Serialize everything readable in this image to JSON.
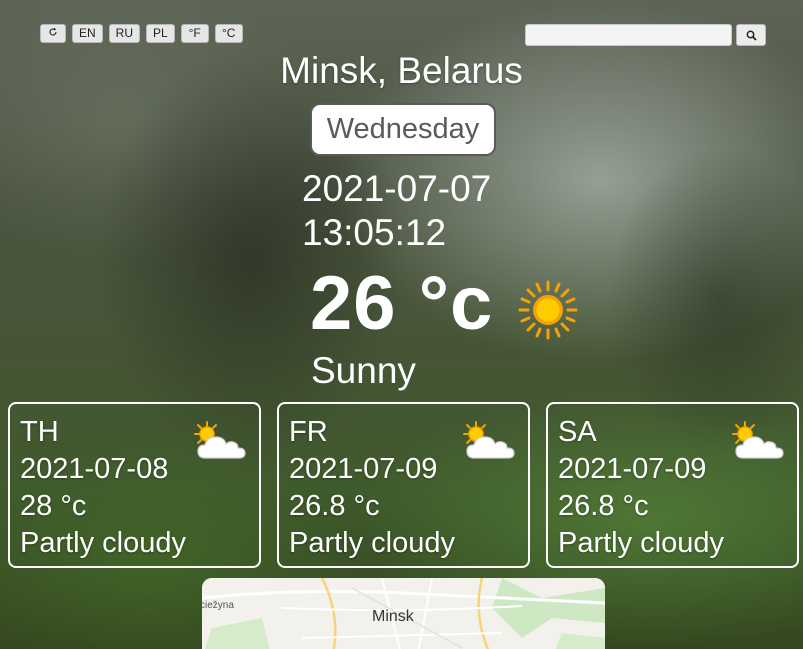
{
  "controls": {
    "refresh_icon": "refresh-icon",
    "languages": [
      "EN",
      "RU",
      "PL"
    ],
    "units": [
      "°F",
      "°C"
    ]
  },
  "search": {
    "value": "",
    "placeholder": "",
    "button_icon": "search-icon"
  },
  "location": {
    "city": "Minsk, Belarus",
    "weekday": "Wednesday",
    "date": "2021-07-07",
    "time": "13:05:12"
  },
  "current": {
    "temperature": "26 °c",
    "condition": "Sunny",
    "icon": "sun-icon"
  },
  "forecast": [
    {
      "day": "TH",
      "date": "2021-07-08",
      "temperature": "28 °c",
      "condition": "Partly cloudy",
      "icon": "partly-cloudy-icon"
    },
    {
      "day": "FR",
      "date": "2021-07-09",
      "temperature": "26.8 °c",
      "condition": "Partly cloudy",
      "icon": "partly-cloudy-icon"
    },
    {
      "day": "SA",
      "date": "2021-07-09",
      "temperature": "26.8 °c",
      "condition": "Partly cloudy",
      "icon": "partly-cloudy-icon"
    }
  ],
  "map": {
    "city_label": "Minsk",
    "place_label": "ciežyna"
  },
  "colors": {
    "sun_core": "#ffcc00",
    "sun_rays": "#f5a300",
    "cloud": "#ffffff"
  }
}
